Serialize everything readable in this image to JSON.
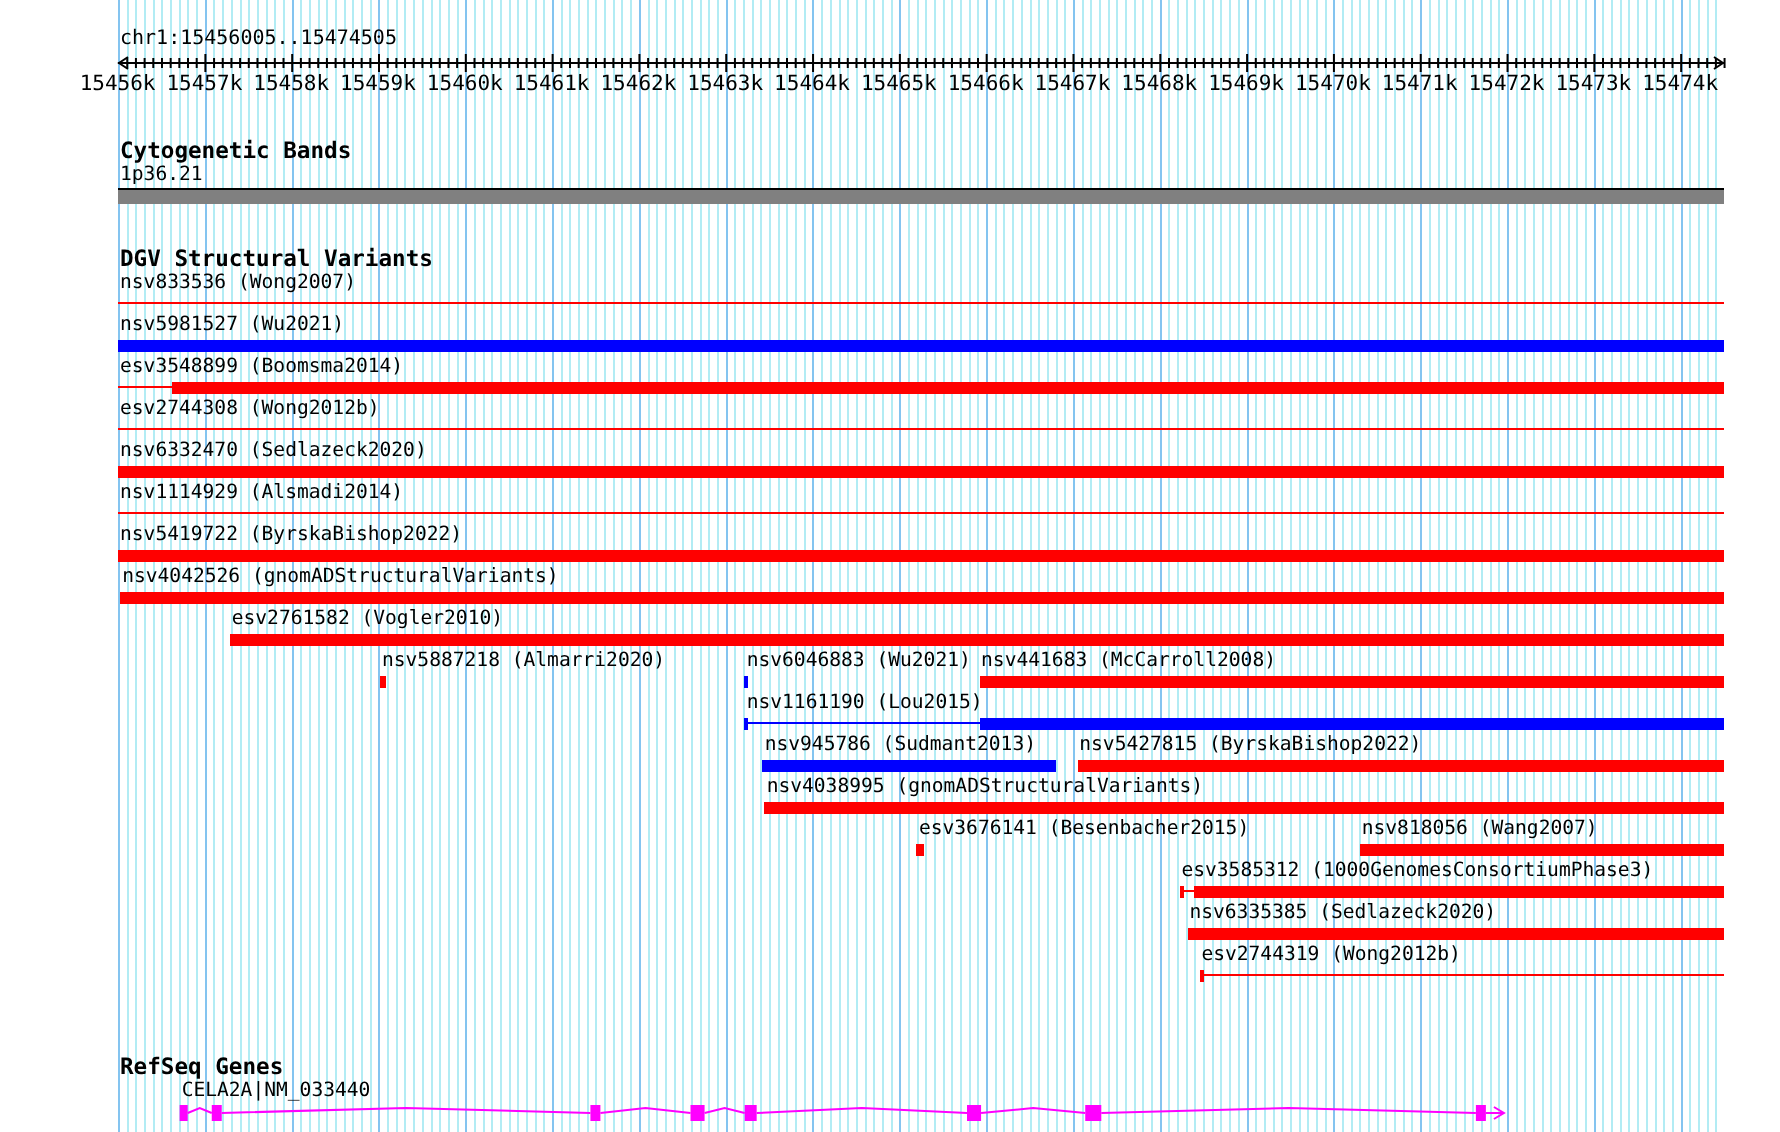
{
  "ruler": {
    "title": "chr1:15456005..15474505",
    "ticks": [
      {
        "label": "15456k"
      },
      {
        "label": "15457k"
      },
      {
        "label": "15458k"
      },
      {
        "label": "15459k"
      },
      {
        "label": "15460k"
      },
      {
        "label": "15461k"
      },
      {
        "label": "15462k"
      },
      {
        "label": "15463k"
      },
      {
        "label": "15464k"
      },
      {
        "label": "15465k"
      },
      {
        "label": "15466k"
      },
      {
        "label": "15467k"
      },
      {
        "label": "15468k"
      },
      {
        "label": "15469k"
      },
      {
        "label": "15470k"
      },
      {
        "label": "15471k"
      },
      {
        "label": "15472k"
      },
      {
        "label": "15473k"
      },
      {
        "label": "15474k"
      }
    ]
  },
  "cytogenetic_bands": {
    "title": "Cytogenetic Bands",
    "bands": [
      {
        "label": "1p36.21"
      }
    ]
  },
  "dgv_structural_variants": {
    "title": "DGV Structural Variants",
    "rows": [
      {
        "features": [
          {
            "label": "nsv833536 (Wong2007)",
            "color": "#ff0000",
            "segments": [
              {
                "kind": "line"
              }
            ]
          }
        ]
      },
      {
        "features": [
          {
            "label": "nsv5981527 (Wu2021)",
            "color": "#0000ff",
            "segments": [
              {
                "kind": "bar"
              }
            ]
          }
        ]
      },
      {
        "features": [
          {
            "label": "esv3548899 (Boomsma2014)",
            "color": "#ff0000",
            "segments": [
              {
                "kind": "line"
              },
              {
                "kind": "bar"
              }
            ]
          }
        ]
      },
      {
        "features": [
          {
            "label": "esv2744308 (Wong2012b)",
            "color": "#ff0000",
            "segments": [
              {
                "kind": "line"
              }
            ]
          }
        ]
      },
      {
        "features": [
          {
            "label": "nsv6332470 (Sedlazeck2020)",
            "color": "#ff0000",
            "segments": [
              {
                "kind": "bar"
              }
            ]
          }
        ]
      },
      {
        "features": [
          {
            "label": "nsv1114929 (Alsmadi2014)",
            "color": "#ff0000",
            "segments": [
              {
                "kind": "line"
              }
            ]
          }
        ]
      },
      {
        "features": [
          {
            "label": "nsv5419722 (ByrskaBishop2022)",
            "color": "#ff0000",
            "segments": [
              {
                "kind": "bar"
              }
            ]
          }
        ]
      },
      {
        "features": [
          {
            "label": "nsv4042526 (gnomADStructuralVariants)",
            "color": "#ff0000",
            "segments": [
              {
                "kind": "bar"
              }
            ]
          }
        ]
      },
      {
        "features": [
          {
            "label": "esv2761582 (Vogler2010)",
            "color": "#ff0000",
            "segments": [
              {
                "kind": "bar"
              }
            ]
          }
        ]
      },
      {
        "features": [
          {
            "label": "nsv5887218 (Almarri2020)",
            "color": "#ff0000",
            "segments": [
              {
                "kind": "bar"
              }
            ]
          },
          {
            "label": "nsv6046883 (Wu2021)",
            "color": "#0000ff",
            "segments": [
              {
                "kind": "bar"
              }
            ]
          },
          {
            "label": "nsv441683 (McCarroll2008)",
            "color": "#ff0000",
            "segments": [
              {
                "kind": "bar"
              }
            ]
          }
        ]
      },
      {
        "features": [
          {
            "label": "nsv1161190 (Lou2015)",
            "color": "#0000ff",
            "segments": [
              {
                "kind": "bar"
              },
              {
                "kind": "line"
              },
              {
                "kind": "bar"
              }
            ]
          }
        ]
      },
      {
        "features": [
          {
            "label": "nsv945786 (Sudmant2013)",
            "color": "#0000ff",
            "segments": [
              {
                "kind": "bar"
              }
            ]
          },
          {
            "label": "nsv5427815 (ByrskaBishop2022)",
            "color": "#ff0000",
            "segments": [
              {
                "kind": "bar"
              }
            ]
          }
        ]
      },
      {
        "features": [
          {
            "label": "nsv4038995 (gnomADStructuralVariants)",
            "color": "#ff0000",
            "segments": [
              {
                "kind": "bar"
              }
            ]
          }
        ]
      },
      {
        "features": [
          {
            "label": "esv3676141 (Besenbacher2015)",
            "color": "#ff0000",
            "segments": [
              {
                "kind": "bar"
              }
            ]
          },
          {
            "label": "nsv818056 (Wang2007)",
            "color": "#ff0000",
            "segments": [
              {
                "kind": "bar"
              }
            ]
          }
        ]
      },
      {
        "features": [
          {
            "label": "esv3585312 (1000GenomesConsortiumPhase3)",
            "color": "#ff0000",
            "segments": [
              {
                "kind": "bar"
              },
              {
                "kind": "line"
              },
              {
                "kind": "bar"
              }
            ]
          }
        ]
      },
      {
        "features": [
          {
            "label": "nsv6335385 (Sedlazeck2020)",
            "color": "#ff0000",
            "segments": [
              {
                "kind": "bar"
              }
            ]
          }
        ]
      },
      {
        "features": [
          {
            "label": "esv2744319 (Wong2012b)",
            "color": "#ff0000",
            "segments": [
              {
                "kind": "bar"
              },
              {
                "kind": "line"
              }
            ]
          }
        ]
      }
    ]
  },
  "refseq_genes": {
    "title": "RefSeq Genes",
    "genes": [
      {
        "label": "CELA2A|NM_033440"
      }
    ]
  }
}
